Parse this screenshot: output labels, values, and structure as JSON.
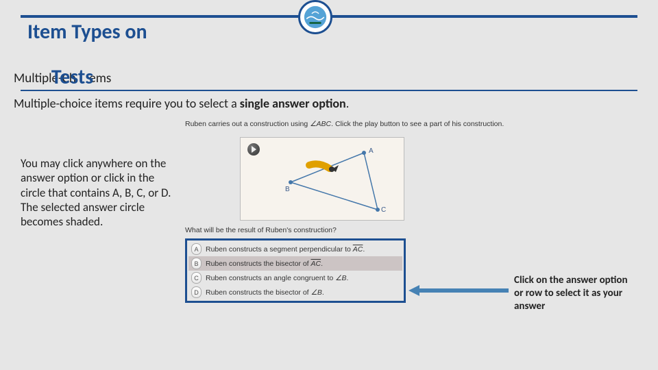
{
  "header": {
    "title_line1": "Item Types on",
    "subtitle_prefix": "Multiple-Ch",
    "subtitle_overlay": "Tests",
    "subtitle_suffix": "ems"
  },
  "description": {
    "text_before": "Multiple-choice items require you to select a ",
    "bold": "single answer option",
    "text_after": "."
  },
  "instruction": "You may click anywhere on the answer option or click in the circle that contains A, B, C, or D. The selected answer circle becomes shaded.",
  "callout": "Click on the answer option or row to select it as your answer",
  "example": {
    "prompt_before": "Ruben carries out a construction using ",
    "prompt_angle": "∠ABC",
    "prompt_after": ". Click the play button to see a part of his construction.",
    "labels": {
      "A": "A",
      "B": "B",
      "C": "C"
    },
    "question2": "What will be the result of Ruben's construction?",
    "options": [
      {
        "key": "A",
        "text_before": "Ruben constructs a segment perpendicular to ",
        "seg": "AC",
        "text_after": ".",
        "selected": false
      },
      {
        "key": "B",
        "text_before": "Ruben constructs the bisector of ",
        "seg": "AC",
        "text_after": ".",
        "selected": true
      },
      {
        "key": "C",
        "text_before": "Ruben constructs an angle congruent to ",
        "ang": "∠B",
        "text_after": ".",
        "selected": false
      },
      {
        "key": "D",
        "text_before": "Ruben constructs the bisector of ",
        "ang": "∠B",
        "text_after": ".",
        "selected": false
      }
    ]
  }
}
